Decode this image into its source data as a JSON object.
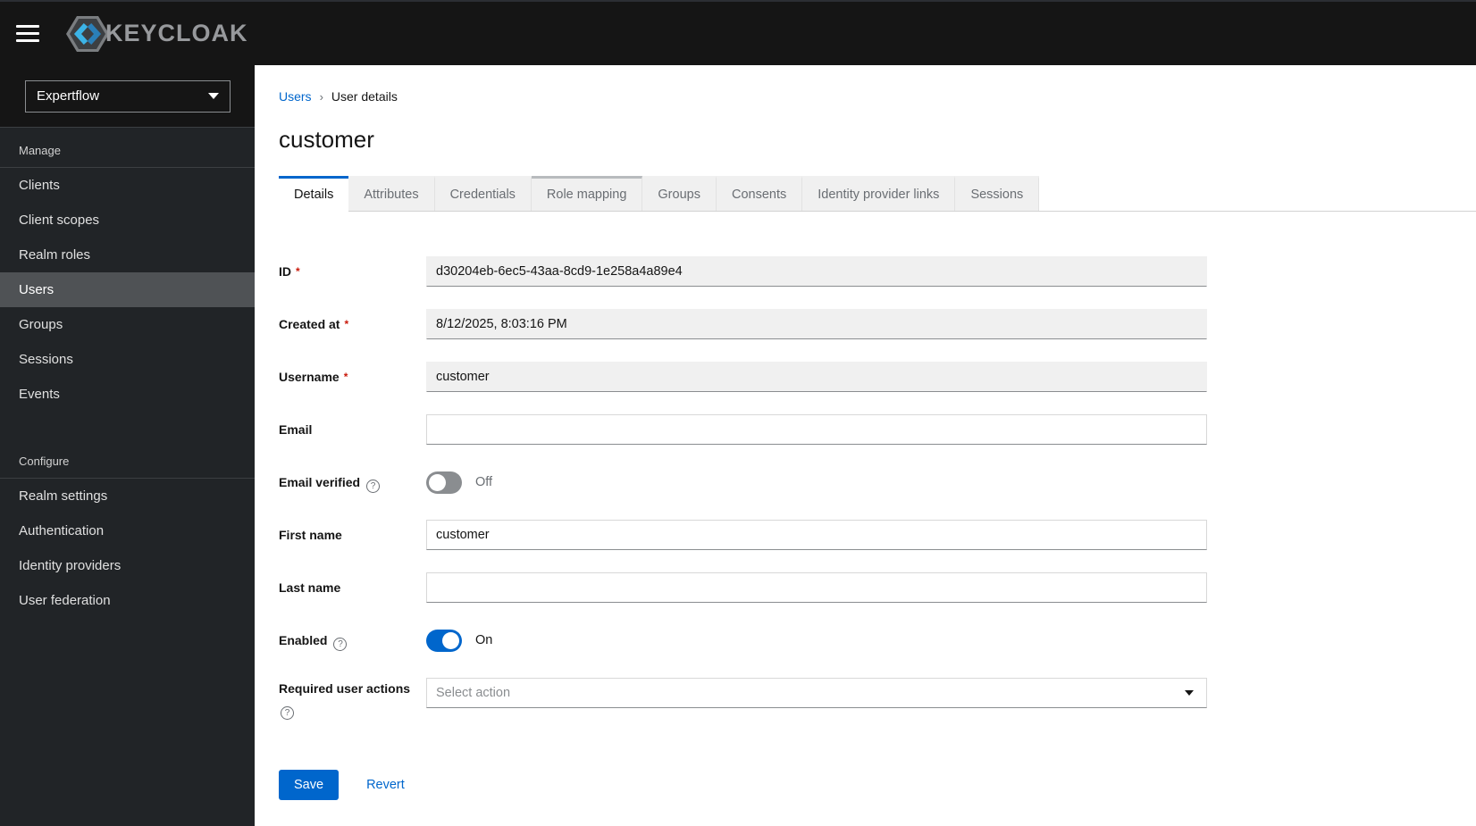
{
  "masthead": {
    "brand_text": "KEYCLOAK"
  },
  "sidebar": {
    "realm_selector": {
      "value": "Expertflow"
    },
    "sections": [
      {
        "label": "Manage",
        "items": [
          {
            "label": "Clients"
          },
          {
            "label": "Client scopes"
          },
          {
            "label": "Realm roles"
          },
          {
            "label": "Users",
            "selected": true
          },
          {
            "label": "Groups"
          },
          {
            "label": "Sessions"
          },
          {
            "label": "Events"
          }
        ]
      },
      {
        "label": "Configure",
        "items": [
          {
            "label": "Realm settings"
          },
          {
            "label": "Authentication"
          },
          {
            "label": "Identity providers"
          },
          {
            "label": "User federation"
          }
        ]
      }
    ]
  },
  "breadcrumb": {
    "items": [
      {
        "label": "Users",
        "link": true
      },
      {
        "label": "User details",
        "link": false
      }
    ]
  },
  "page": {
    "title": "customer"
  },
  "tabs": {
    "items": [
      {
        "label": "Details",
        "active": true
      },
      {
        "label": "Attributes"
      },
      {
        "label": "Credentials"
      },
      {
        "label": "Role mapping",
        "hovered": true
      },
      {
        "label": "Groups"
      },
      {
        "label": "Consents"
      },
      {
        "label": "Identity provider links"
      },
      {
        "label": "Sessions"
      }
    ]
  },
  "form": {
    "id": {
      "label": "ID",
      "required": "*",
      "value": "d30204eb-6ec5-43aa-8cd9-1e258a4a89e4",
      "disabled": true
    },
    "created_at": {
      "label": "Created at",
      "required": "*",
      "value": "8/12/2025, 8:03:16 PM",
      "disabled": true
    },
    "username": {
      "label": "Username",
      "required": "*",
      "value": "customer",
      "disabled": true
    },
    "email": {
      "label": "Email",
      "value": ""
    },
    "email_verified": {
      "label": "Email verified",
      "state_label": "Off",
      "state": "off"
    },
    "first_name": {
      "label": "First name",
      "value": "customer"
    },
    "last_name": {
      "label": "Last name",
      "value": ""
    },
    "enabled": {
      "label": "Enabled",
      "state_label": "On",
      "state": "on"
    },
    "required_user_actions": {
      "label": "Required user actions",
      "placeholder": "Select action"
    }
  },
  "actions": {
    "save_label": "Save",
    "revert_label": "Revert"
  },
  "colors": {
    "accent_blue": "#0066cc",
    "masthead_bg": "#151515",
    "sidebar_bg": "#212427",
    "nav_selected_bg": "#4f5255",
    "tab_inactive_bg": "#f0f0f0",
    "disabled_input_bg": "#f0f0f0",
    "input_bottom_border": "#8a8d90",
    "required_asterisk": "#c9190b",
    "toggle_on": "#0066cc",
    "toggle_off": "#8a8d90"
  }
}
